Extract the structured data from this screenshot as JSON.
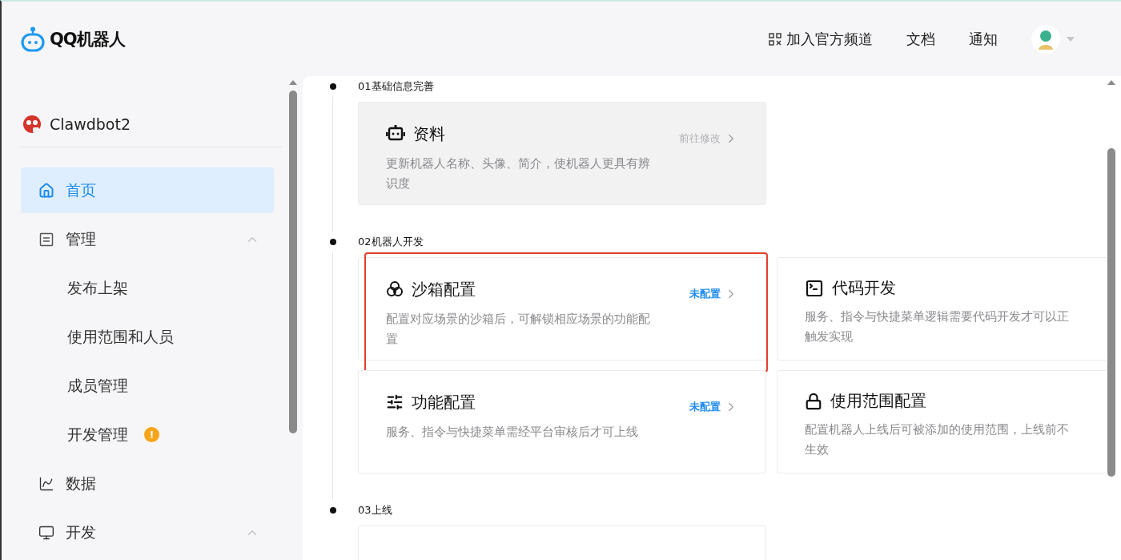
{
  "header": {
    "logo": "QQ机器人",
    "nav": [
      {
        "label": "加入官方频道",
        "kind": "channel"
      },
      {
        "label": "文档",
        "kind": "plain"
      },
      {
        "label": "通知",
        "kind": "plain"
      }
    ]
  },
  "sidebar": {
    "bot_name": "Clawdbot2",
    "items": [
      {
        "label": "首页",
        "kind": "home",
        "selected": true
      },
      {
        "label": "管理",
        "kind": "doc",
        "selected": false,
        "expanded": true,
        "children": [
          {
            "label": "发布上架",
            "selected": false
          },
          {
            "label": "使用范围和人员",
            "selected": false
          },
          {
            "label": "成员管理",
            "selected": false
          },
          {
            "label": "开发管理",
            "selected": false,
            "badge": "!"
          }
        ]
      },
      {
        "label": "数据",
        "kind": "chart",
        "selected": false
      },
      {
        "label": "开发",
        "kind": "monitor",
        "selected": false,
        "expanded": true
      }
    ]
  },
  "steps": [
    {
      "label": "01基础信息完善",
      "cards": [
        {
          "title": "资料",
          "kind": "robot",
          "status": "前往修改",
          "pending": false,
          "shaded": true,
          "annotated": false,
          "description": [
            "更新机器人名称、头像、简介，使机器人更具有辨",
            "识度"
          ]
        }
      ]
    },
    {
      "label": "02机器人开发",
      "cards": [
        {
          "title": "沙箱配置",
          "kind": "circles",
          "status": "未配置",
          "pending": true,
          "shaded": false,
          "annotated": true,
          "description": [
            "配置对应场景的沙箱后，可解锁相应场景的功能配",
            "置"
          ]
        },
        {
          "title": "代码开发",
          "kind": "terminal",
          "shaded": false,
          "annotated": false,
          "description": [
            "服务、指令与快捷菜单逻辑需要代码开发才可以正",
            "触发实现"
          ]
        },
        {
          "title": "功能配置",
          "kind": "sliders",
          "status": "未配置",
          "pending": true,
          "shaded": false,
          "annotated": false,
          "description": [
            "服务、指令与快捷菜单需经平台审核后才可上线"
          ]
        },
        {
          "title": "使用范围配置",
          "kind": "lock",
          "shaded": false,
          "annotated": false,
          "description": [
            "配置机器人上线后可被添加的使用范围，上线前不",
            "生效"
          ]
        }
      ]
    },
    {
      "label": "03上线",
      "cards": [
        {
          "kind": "cut"
        }
      ]
    }
  ]
}
